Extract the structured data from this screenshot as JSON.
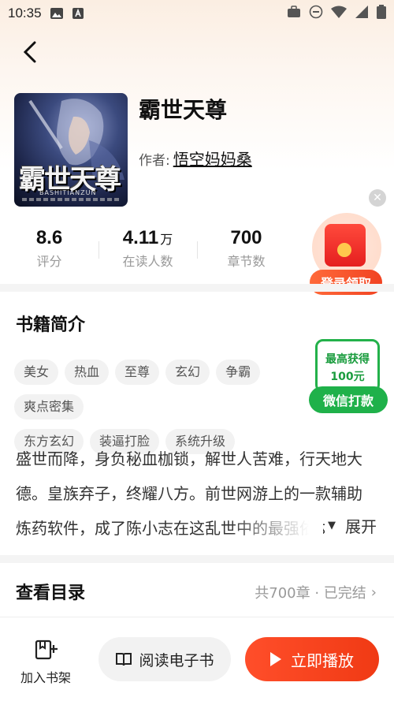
{
  "status_bar": {
    "time": "10:35"
  },
  "book": {
    "title": "霸世天尊",
    "author_label": "作者:",
    "author_name": "悟空妈妈桑",
    "cover_title_art": "霸世天尊",
    "cover_pinyin": "BASHITIANZUN"
  },
  "stats": [
    {
      "value": "8.6",
      "unit": "",
      "label": "评分"
    },
    {
      "value": "4.11",
      "unit": "万",
      "label": "在读人数"
    },
    {
      "value": "700",
      "unit": "",
      "label": "章节数"
    }
  ],
  "promo": {
    "close_symbol": "✕",
    "redpack_label": "登录领取",
    "wechat_line1": "最高获得",
    "wechat_line2": "100元",
    "wechat_button": "微信打款"
  },
  "intro": {
    "section_title": "书籍简介",
    "tags": [
      "美女",
      "热血",
      "至尊",
      "玄幻",
      "争霸",
      "爽点密集",
      "东方玄幻",
      "装逼打脸",
      "系统升级"
    ],
    "synopsis": "盛世而降，身负秘血枷锁，解世人苦难，行天地大德。皇族弃子，终耀八方。前世网游上的一款辅助炼药软件，成了陈小志在这乱世中的最强依仗",
    "expand_label": "展开"
  },
  "catalog": {
    "section_title": "查看目录",
    "info": "共700章 · 已完结",
    "chevron": "›"
  },
  "bottom": {
    "shelf_label": "加入书架",
    "read_label": "阅读电子书",
    "play_label": "立即播放"
  },
  "colors": {
    "accent_red": "#f03a14",
    "wechat_green": "#1fb14a"
  }
}
